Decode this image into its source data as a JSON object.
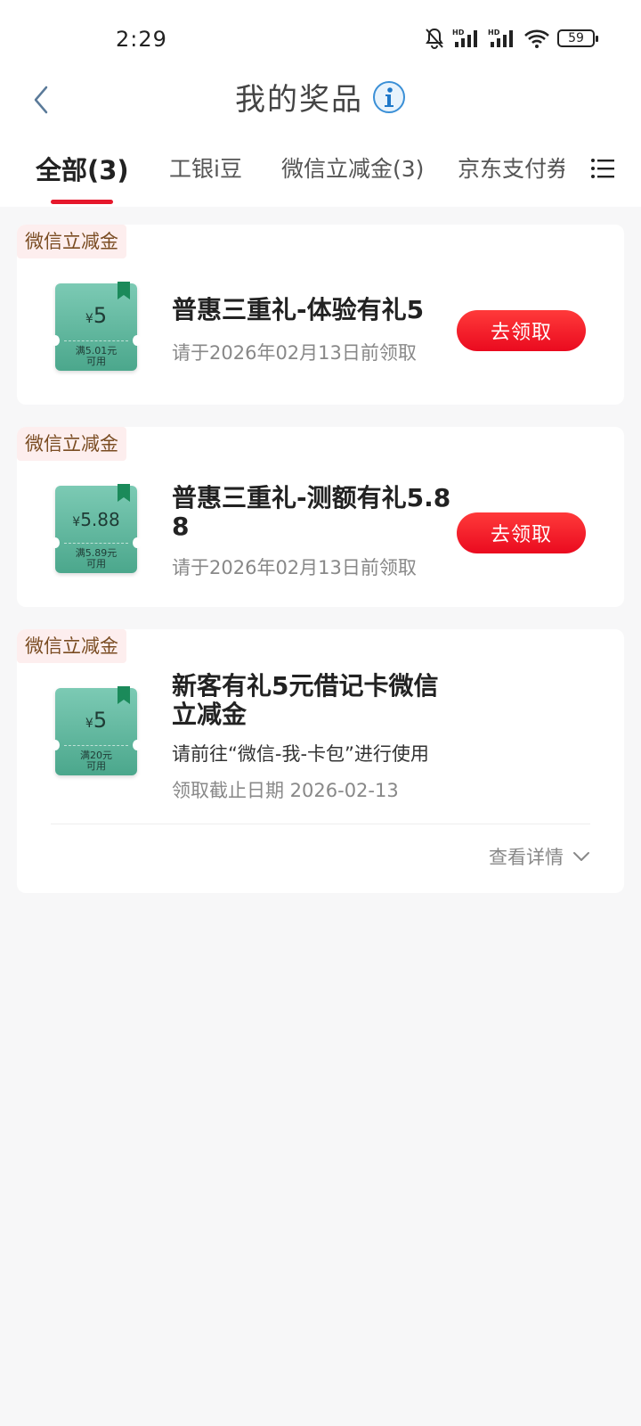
{
  "status_bar": {
    "time": "2:29",
    "battery": "59"
  },
  "header": {
    "title": "我的奖品"
  },
  "tabs": [
    {
      "label": "全部(3)"
    },
    {
      "label": "工银i豆"
    },
    {
      "label": "微信立减金(3)"
    },
    {
      "label": "京东支付券"
    }
  ],
  "cards": [
    {
      "tag": "微信立减金",
      "coupon_symbol": "¥",
      "coupon_amount": "5",
      "coupon_condition_line1": "满5.01元",
      "coupon_condition_line2": "可用",
      "title": "普惠三重礼-体验有礼5",
      "deadline": "请于2026年02月13日前领取",
      "button": "去领取"
    },
    {
      "tag": "微信立减金",
      "coupon_symbol": "¥",
      "coupon_amount": "5.88",
      "coupon_condition_line1": "满5.89元",
      "coupon_condition_line2": "可用",
      "title_line1": "普惠三重礼-测额有礼5.8",
      "title_line2": "8",
      "deadline": "请于2026年02月13日前领取",
      "button": "去领取"
    },
    {
      "tag": "微信立减金",
      "coupon_symbol": "¥",
      "coupon_amount": "5",
      "coupon_condition_line1": "满20元",
      "coupon_condition_line2": "可用",
      "title_line1": "新客有礼5元借记卡微信",
      "title_line2": "立减金",
      "instruction": "请前往“微信-我-卡包”进行使用",
      "deadline": "领取截止日期 2026-02-13",
      "details": "查看详情"
    }
  ],
  "colors": {
    "accent_red": "#e6182c",
    "coupon_green": "#5bb59a",
    "tag_bg": "#fdeeee"
  }
}
